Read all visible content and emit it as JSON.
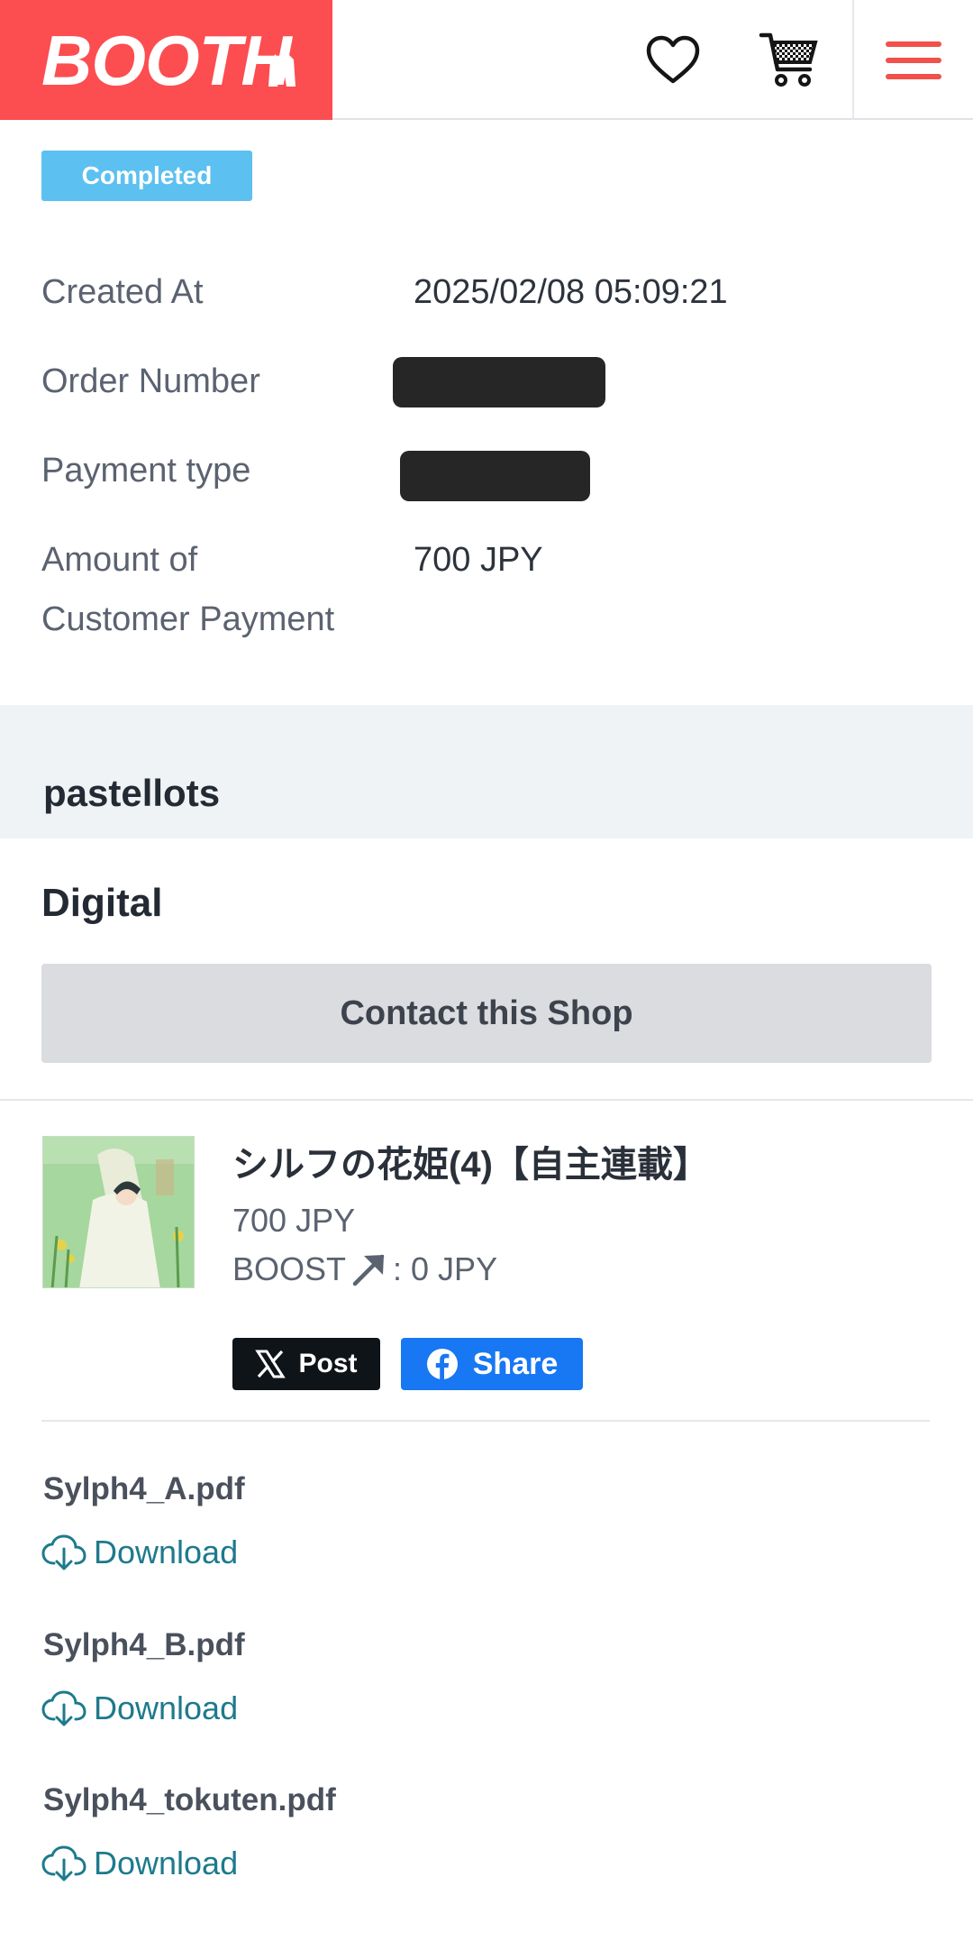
{
  "header": {
    "logo_text": "BOOTH",
    "brand_color": "#fc4d50",
    "icons": [
      "heart-icon",
      "cart-icon",
      "menu-icon"
    ]
  },
  "order": {
    "status": "Completed",
    "rows": [
      {
        "label": "Created At",
        "value": "2025/02/08 05:09:21"
      },
      {
        "label": "Order Number",
        "value": ""
      },
      {
        "label": "Payment type",
        "value": ""
      },
      {
        "label_line1": "Amount of",
        "label_line2": "Customer Payment",
        "value": "700 JPY"
      }
    ]
  },
  "shop": {
    "name": "pastellots",
    "type_heading": "Digital",
    "contact_label": "Contact this Shop"
  },
  "item": {
    "title": "シルフの花姫(4)【自主連載】",
    "price": "700 JPY",
    "boost_label": "BOOST",
    "boost_value": ": 0 JPY",
    "post_label": "Post",
    "share_label": "Share"
  },
  "files": [
    {
      "name": "Sylph4_A.pdf",
      "action": "Download"
    },
    {
      "name": "Sylph4_B.pdf",
      "action": "Download"
    },
    {
      "name": "Sylph4_tokuten.pdf",
      "action": "Download"
    }
  ]
}
